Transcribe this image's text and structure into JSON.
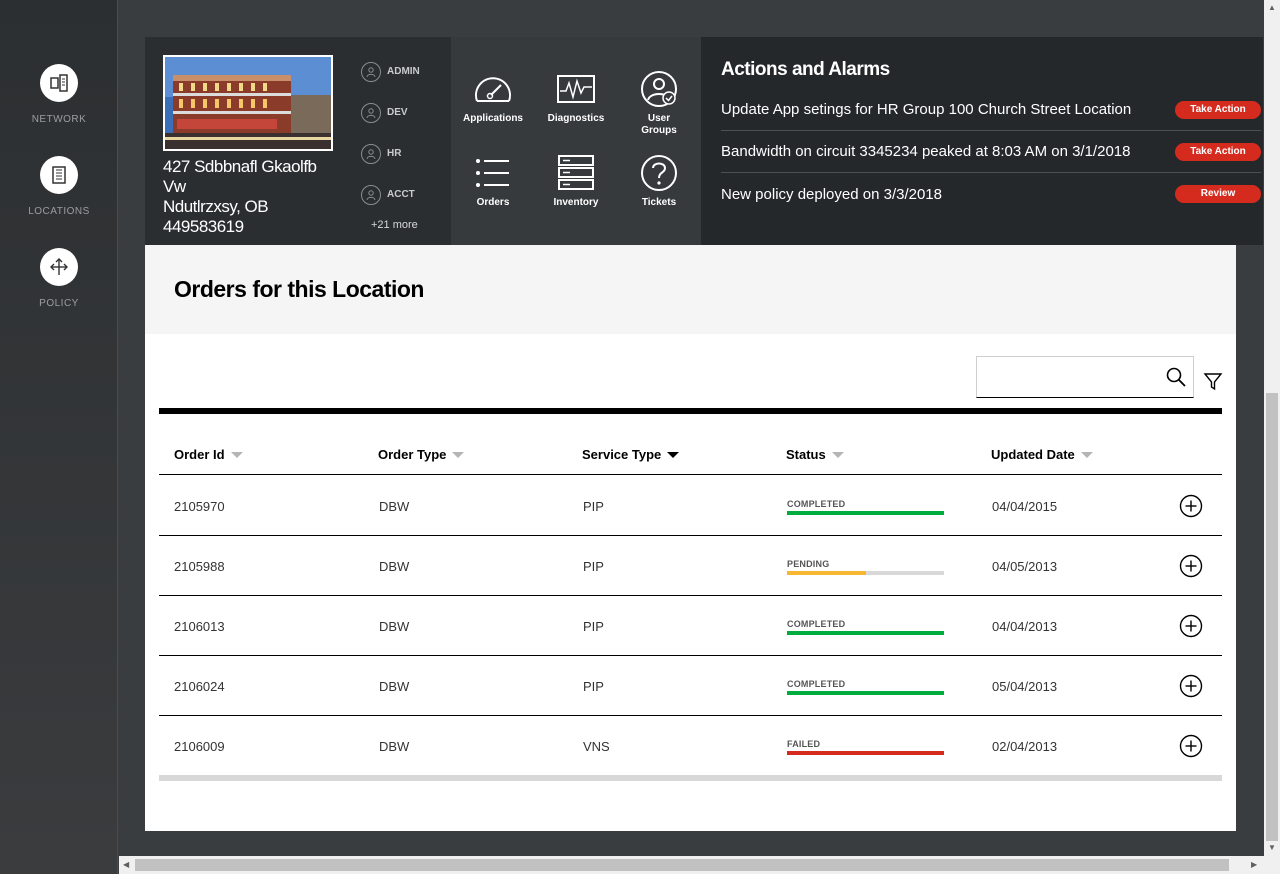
{
  "sidebar": {
    "items": [
      {
        "label": "NETWORK",
        "icon": "network-icon"
      },
      {
        "label": "LOCATIONS",
        "icon": "building-icon"
      },
      {
        "label": "POLICY",
        "icon": "move-arrows-icon"
      }
    ]
  },
  "location": {
    "address_line1": "427 Sdbbnafl Gkaolfb",
    "address_line2": "Vw",
    "address_line3": "Ndutlrzxsy, OB",
    "address_line4": "449583619",
    "groups": [
      "ADMIN",
      "DEV",
      "HR",
      "ACCT"
    ],
    "more": "+21 more"
  },
  "apps": [
    {
      "label": "Applications",
      "icon": "gauge-icon"
    },
    {
      "label": "Diagnostics",
      "icon": "waveform-icon"
    },
    {
      "label": "User Groups",
      "icon": "user-check-icon"
    },
    {
      "label": "Orders",
      "icon": "list-icon"
    },
    {
      "label": "Inventory",
      "icon": "server-icon"
    },
    {
      "label": "Tickets",
      "icon": "question-icon"
    }
  ],
  "alarms": {
    "title": "Actions and Alarms",
    "items": [
      {
        "text": "Update App setings for HR Group 100 Church Street Location",
        "action": "Take Action"
      },
      {
        "text": "Bandwidth on circuit 3345234 peaked at 8:03 AM on 3/1/2018",
        "action": "Take Action"
      },
      {
        "text": "New policy deployed on 3/3/2018",
        "action": "Review"
      }
    ],
    "button_color": "#d52b1e"
  },
  "orders": {
    "title": "Orders for this Location",
    "search_placeholder": "",
    "columns": [
      "Order Id",
      "Order Type",
      "Service Type",
      "Status",
      "Updated Date"
    ],
    "sorted_column": "Service Type",
    "rows": [
      {
        "id": "2105970",
        "type": "DBW",
        "service": "PIP",
        "status": "COMPLETED",
        "progress": 1.0,
        "color": "#00ac3e",
        "date": "04/04/2015"
      },
      {
        "id": "2105988",
        "type": "DBW",
        "service": "PIP",
        "status": "PENDING",
        "progress": 0.5,
        "color": "#f7b731",
        "date": "04/05/2013"
      },
      {
        "id": "2106013",
        "type": "DBW",
        "service": "PIP",
        "status": "COMPLETED",
        "progress": 1.0,
        "color": "#00ac3e",
        "date": "04/04/2013"
      },
      {
        "id": "2106024",
        "type": "DBW",
        "service": "PIP",
        "status": "COMPLETED",
        "progress": 1.0,
        "color": "#00ac3e",
        "date": "05/04/2013"
      },
      {
        "id": "2106009",
        "type": "DBW",
        "service": "VNS",
        "status": "FAILED",
        "progress": 1.0,
        "color": "#d52b1e",
        "date": "02/04/2013"
      }
    ]
  }
}
